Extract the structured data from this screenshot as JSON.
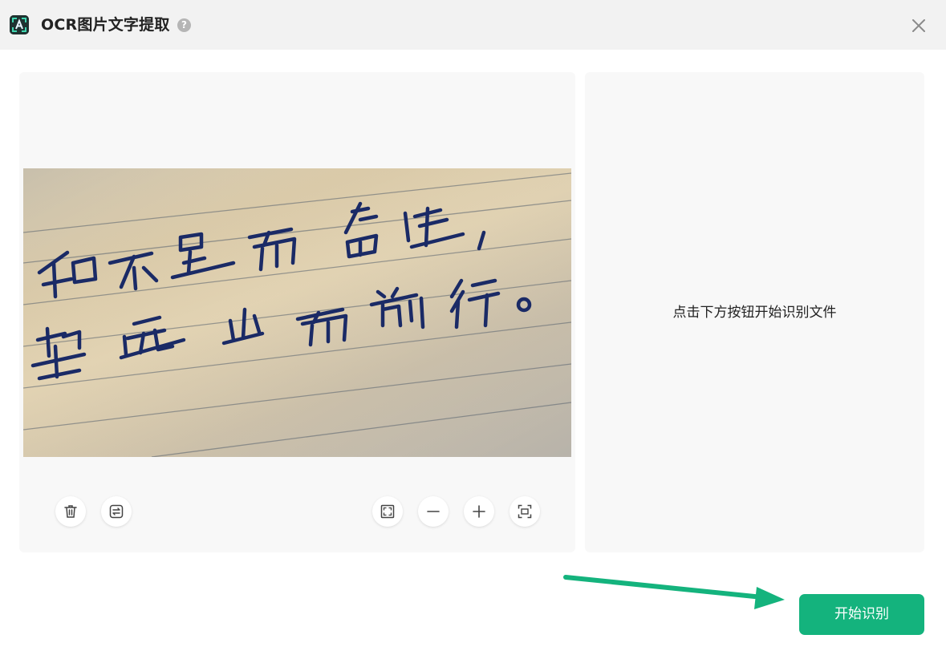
{
  "window": {
    "title": "OCR图片文字提取",
    "help_glyph": "?",
    "icons": {
      "logo": "ocr-app-logo-icon",
      "help": "help-circle-icon",
      "close": "close-icon"
    }
  },
  "right_panel": {
    "hint": "点击下方按钮开始识别文件"
  },
  "preview": {
    "handwriting_line_1": "知不足而奋进，",
    "handwriting_line_2": "望远山而前行。"
  },
  "toolbar": {
    "left_tools": [
      "trash-icon",
      "swap-icon"
    ],
    "right_tools": [
      "fit-screen-icon",
      "zoom-out-icon",
      "zoom-in-icon",
      "scan-icon"
    ]
  },
  "actions": {
    "start_label": "开始识别"
  },
  "colors": {
    "accent": "#14b37d",
    "titlebar_bg": "#f2f2f2",
    "panel_bg": "#f8f8f8",
    "ink": "#1a2a66"
  }
}
